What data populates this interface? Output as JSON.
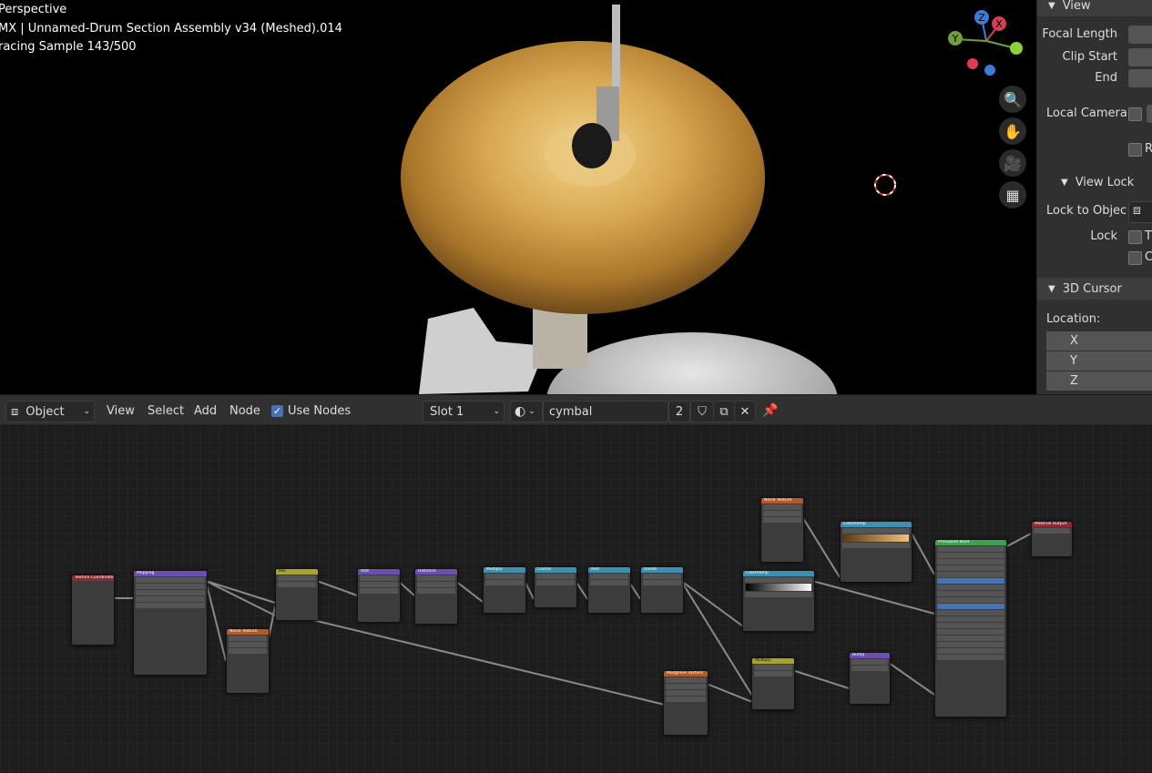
{
  "viewport": {
    "lines": [
      "Perspective",
      "MX | Unnamed-Drum Section Assembly v34 (Meshed).014",
      "racing Sample 143/500"
    ],
    "gizmo_axes": {
      "z": "Z",
      "x": "X",
      "y": "Y"
    },
    "nav_buttons": [
      "zoom-icon",
      "hand-icon",
      "camera-icon",
      "grid-icon"
    ]
  },
  "sidebar": {
    "view_panel": "View",
    "focal_length": "Focal Length",
    "clip_start": "Clip Start",
    "clip_end": "End",
    "local_camera": "Local Camera",
    "r_label": "R",
    "view_lock_panel": "View Lock",
    "lock_to_object": "Lock to Objec",
    "lock": "Lock",
    "lock_t": "T",
    "lock_c": "C",
    "cursor_panel": "3D Cursor",
    "location": "Location:",
    "x": "X",
    "y": "Y",
    "z": "Z"
  },
  "header": {
    "mode": "Object",
    "menus": [
      "View",
      "Select",
      "Add",
      "Node"
    ],
    "use_nodes": "Use Nodes",
    "slot": "Slot 1",
    "material": "cymbal",
    "users": "2"
  },
  "nodes": [
    {
      "title": "Texture Coordinate",
      "color": "#8e2a34"
    },
    {
      "title": "Mapping",
      "color": "#6b4fb0"
    },
    {
      "title": "Noise Texture",
      "color": "#b35a2a"
    },
    {
      "title": "Mix",
      "color": "#a8a234"
    },
    {
      "title": "Add",
      "color": "#6b4fb0"
    },
    {
      "title": "Distance",
      "color": "#6b4fb0"
    },
    {
      "title": "Multiply",
      "color": "#3f8fb0"
    },
    {
      "title": "Cosine",
      "color": "#3f8fb0"
    },
    {
      "title": "Add",
      "color": "#3f8fb0"
    },
    {
      "title": "Divide",
      "color": "#3f8fb0"
    },
    {
      "title": "Noise Texture",
      "color": "#b35a2a"
    },
    {
      "title": "ColorRamp",
      "color": "#3f8fb0"
    },
    {
      "title": "ColorRamp",
      "color": "#3f8fb0"
    },
    {
      "title": "Musgrave Texture",
      "color": "#b35a2a"
    },
    {
      "title": "Multiply",
      "color": "#a8a234"
    },
    {
      "title": "Bump",
      "color": "#6b4fb0"
    },
    {
      "title": "Principled BSDF",
      "color": "#3fa04f"
    },
    {
      "title": "Material Output",
      "color": "#8e2a34"
    }
  ]
}
